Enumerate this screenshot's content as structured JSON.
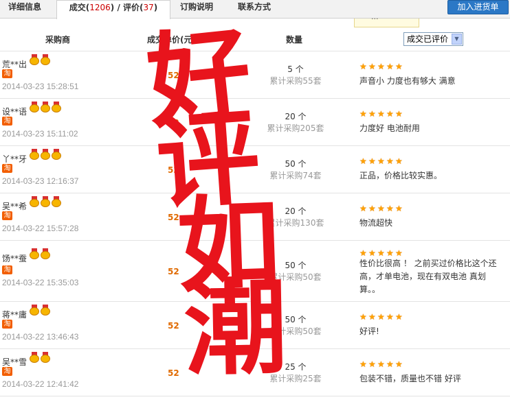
{
  "tabs": {
    "details": "详细信息",
    "deal_label": "成交(",
    "deal_count": "1206",
    "review_sep": ") / 评价(",
    "review_count": "37",
    "review_close": ")",
    "purchase_info": "订购说明",
    "contact": "联系方式"
  },
  "add_button": "加入进货单",
  "tooltip_text": "...",
  "header": {
    "buyer": "采购商",
    "price": "成交单价(元)",
    "qty": "数量",
    "filter_selected": "成交已评价"
  },
  "stamp": {
    "line1": "好",
    "line2": "评",
    "line3": "如",
    "line4": "潮"
  },
  "rows": [
    {
      "buyer": "荒**出",
      "medals": 2,
      "time": "2014-03-23 15:28:51",
      "price": "52",
      "qty": "5 个",
      "total": "累计采购55套",
      "stars": 5,
      "comment": "声音小 力度也有够大 满意"
    },
    {
      "buyer": "设**语",
      "medals": 3,
      "time": "2014-03-23 15:11:02",
      "price": "52",
      "qty": "20 个",
      "total": "累计采购205套",
      "stars": 5,
      "comment": "力度好 电池耐用"
    },
    {
      "buyer": "丫**牙",
      "medals": 3,
      "time": "2014-03-23 12:16:37",
      "price": "52",
      "qty": "50 个",
      "total": "累计采购74套",
      "stars": 5,
      "comment": "正品，价格比较实惠。"
    },
    {
      "buyer": "吴**希",
      "medals": 3,
      "time": "2014-03-22 15:57:28",
      "price": "52",
      "qty": "20 个",
      "total": "累计采购130套",
      "stars": 5,
      "comment": "物流超快"
    },
    {
      "buyer": "饧**蚕",
      "medals": 2,
      "time": "2014-03-22 15:35:03",
      "price": "52",
      "qty": "50 个",
      "total": "累计采购50套",
      "stars": 5,
      "comment": "性价比很高 ！ 之前买过价格比这个还高，才单电池，现在有双电池 真划算。。"
    },
    {
      "buyer": "蒋**庸",
      "medals": 2,
      "time": "2014-03-22 13:46:43",
      "price": "52",
      "qty": "50 个",
      "total": "累计采购50套",
      "stars": 5,
      "comment": "好评!"
    },
    {
      "buyer": "吴**雪",
      "medals": 2,
      "time": "2014-03-22 12:41:42",
      "price": "52",
      "qty": "25 个",
      "total": "累计采购25套",
      "stars": 5,
      "comment": "包装不错，质量也不错 好评"
    }
  ],
  "taobao_badge": "淘",
  "colors": {
    "accent": "#2b78c6",
    "price": "#e06a00",
    "stamp": "#e8141c",
    "star": "#ffa200"
  }
}
